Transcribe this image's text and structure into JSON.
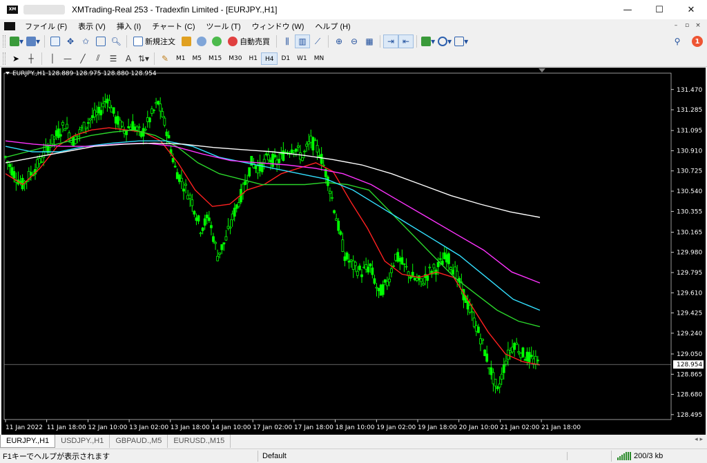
{
  "window": {
    "title": "XMTrading-Real 253 - Tradexfin Limited - [EURJPY.,H1]",
    "logo_text": "XM",
    "controls": {
      "minimize": "—",
      "maximize": "☐",
      "close": "✕"
    }
  },
  "menu": {
    "items": [
      "ファイル (F)",
      "表示 (V)",
      "挿入 (I)",
      "チャート (C)",
      "ツール (T)",
      "ウィンドウ (W)",
      "ヘルプ (H)"
    ],
    "mdi": [
      "–",
      "▫",
      "×"
    ]
  },
  "toolbar1": {
    "new_order": "新規注文",
    "auto_trade": "自動売買",
    "notification_count": "1"
  },
  "toolbar2": {
    "timeframes": [
      "M1",
      "M5",
      "M15",
      "M30",
      "H1",
      "H4",
      "D1",
      "W1",
      "MN"
    ],
    "active_timeframe": "H4",
    "text_tool": "A"
  },
  "chart": {
    "header": "EURJPY.,H1  128.889 128.975 128.880 128.954",
    "current_price": "128.954",
    "bg_color": "#000000",
    "candle_color": "#00ff00"
  },
  "chart_data": {
    "type": "line",
    "symbol": "EURJPY.",
    "timeframe": "H1",
    "ohlc_last": {
      "open": 128.889,
      "high": 128.975,
      "low": 128.88,
      "close": 128.954
    },
    "y_ticks": [
      131.47,
      131.285,
      131.095,
      130.91,
      130.725,
      130.54,
      130.355,
      130.165,
      129.98,
      129.795,
      129.61,
      129.425,
      129.24,
      129.05,
      128.865,
      128.68,
      128.495
    ],
    "x_ticks": [
      "11 Jan 2022",
      "11 Jan 18:00",
      "12 Jan 10:00",
      "13 Jan 02:00",
      "13 Jan 18:00",
      "14 Jan 10:00",
      "17 Jan 02:00",
      "17 Jan 18:00",
      "18 Jan 10:00",
      "19 Jan 02:00",
      "19 Jan 18:00",
      "20 Jan 10:00",
      "21 Jan 02:00",
      "21 Jan 18:00"
    ],
    "ylim": [
      128.45,
      131.62
    ],
    "price": [
      130.85,
      130.7,
      130.6,
      130.7,
      130.8,
      130.95,
      131.05,
      131.15,
      131.0,
      131.1,
      131.2,
      131.25,
      131.4,
      131.2,
      131.1,
      131.15,
      131.05,
      131.2,
      131.35,
      131.1,
      130.75,
      130.6,
      130.45,
      130.2,
      130.3,
      129.95,
      130.1,
      130.35,
      130.55,
      130.8,
      130.75,
      130.85,
      130.8,
      130.9,
      130.95,
      130.85,
      131.0,
      130.9,
      130.65,
      130.3,
      129.95,
      129.85,
      129.8,
      129.85,
      129.6,
      129.7,
      129.95,
      129.85,
      129.75,
      129.7,
      129.8,
      129.85,
      129.95,
      129.8,
      129.6,
      129.4,
      129.2,
      128.95,
      128.7,
      129.0,
      129.15,
      129.05,
      129.0,
      128.95
    ],
    "series": [
      {
        "name": "MA red",
        "color": "#ff2020",
        "values": [
          130.7,
          130.6,
          130.75,
          130.95,
          131.05,
          131.1,
          131.12,
          131.1,
          131.08,
          131.0,
          130.8,
          130.55,
          130.4,
          130.42,
          130.55,
          130.6,
          130.7,
          130.75,
          130.8,
          130.72,
          130.45,
          130.2,
          129.9,
          129.78,
          129.75,
          129.8,
          129.75,
          129.5,
          129.25,
          129.05,
          128.98,
          128.95
        ]
      },
      {
        "name": "MA green",
        "color": "#2bd62b",
        "values": [
          130.85,
          130.9,
          130.95,
          131.0,
          131.05,
          131.08,
          131.1,
          131.05,
          130.95,
          130.8,
          130.7,
          130.65,
          130.6,
          130.6,
          130.6,
          130.62,
          130.6,
          130.55,
          130.35,
          130.15,
          129.95,
          129.75,
          129.6,
          129.45,
          129.35,
          129.3
        ]
      },
      {
        "name": "MA cyan",
        "color": "#33e0ff",
        "values": [
          130.95,
          130.9,
          130.9,
          130.95,
          130.98,
          131.0,
          131.0,
          130.95,
          130.85,
          130.8,
          130.75,
          130.7,
          130.65,
          130.55,
          130.4,
          130.25,
          130.1,
          129.95,
          129.75,
          129.55,
          129.45
        ]
      },
      {
        "name": "MA magenta",
        "color": "#ff33ff",
        "values": [
          131.0,
          130.97,
          130.95,
          130.95,
          130.97,
          130.98,
          130.95,
          130.88,
          130.82,
          130.8,
          130.78,
          130.75,
          130.7,
          130.6,
          130.45,
          130.3,
          130.15,
          130.0,
          129.8,
          129.7
        ]
      },
      {
        "name": "MA white",
        "color": "#ffffff",
        "values": [
          130.8,
          130.85,
          130.9,
          130.95,
          130.97,
          130.98,
          130.97,
          130.94,
          130.92,
          130.9,
          130.87,
          130.83,
          130.78,
          130.7,
          130.6,
          130.5,
          130.42,
          130.35,
          130.3
        ]
      }
    ],
    "grid": false,
    "legend": "none"
  },
  "tabs": {
    "items": [
      "EURJPY.,H1",
      "USDJPY.,H1",
      "GBPAUD.,M5",
      "EURUSD.,M15"
    ],
    "active_index": 0,
    "scroll": "◂ ▸"
  },
  "status": {
    "help": "F1キーでヘルプが表示されます",
    "profile": "Default",
    "traffic": "200/3 kb"
  }
}
